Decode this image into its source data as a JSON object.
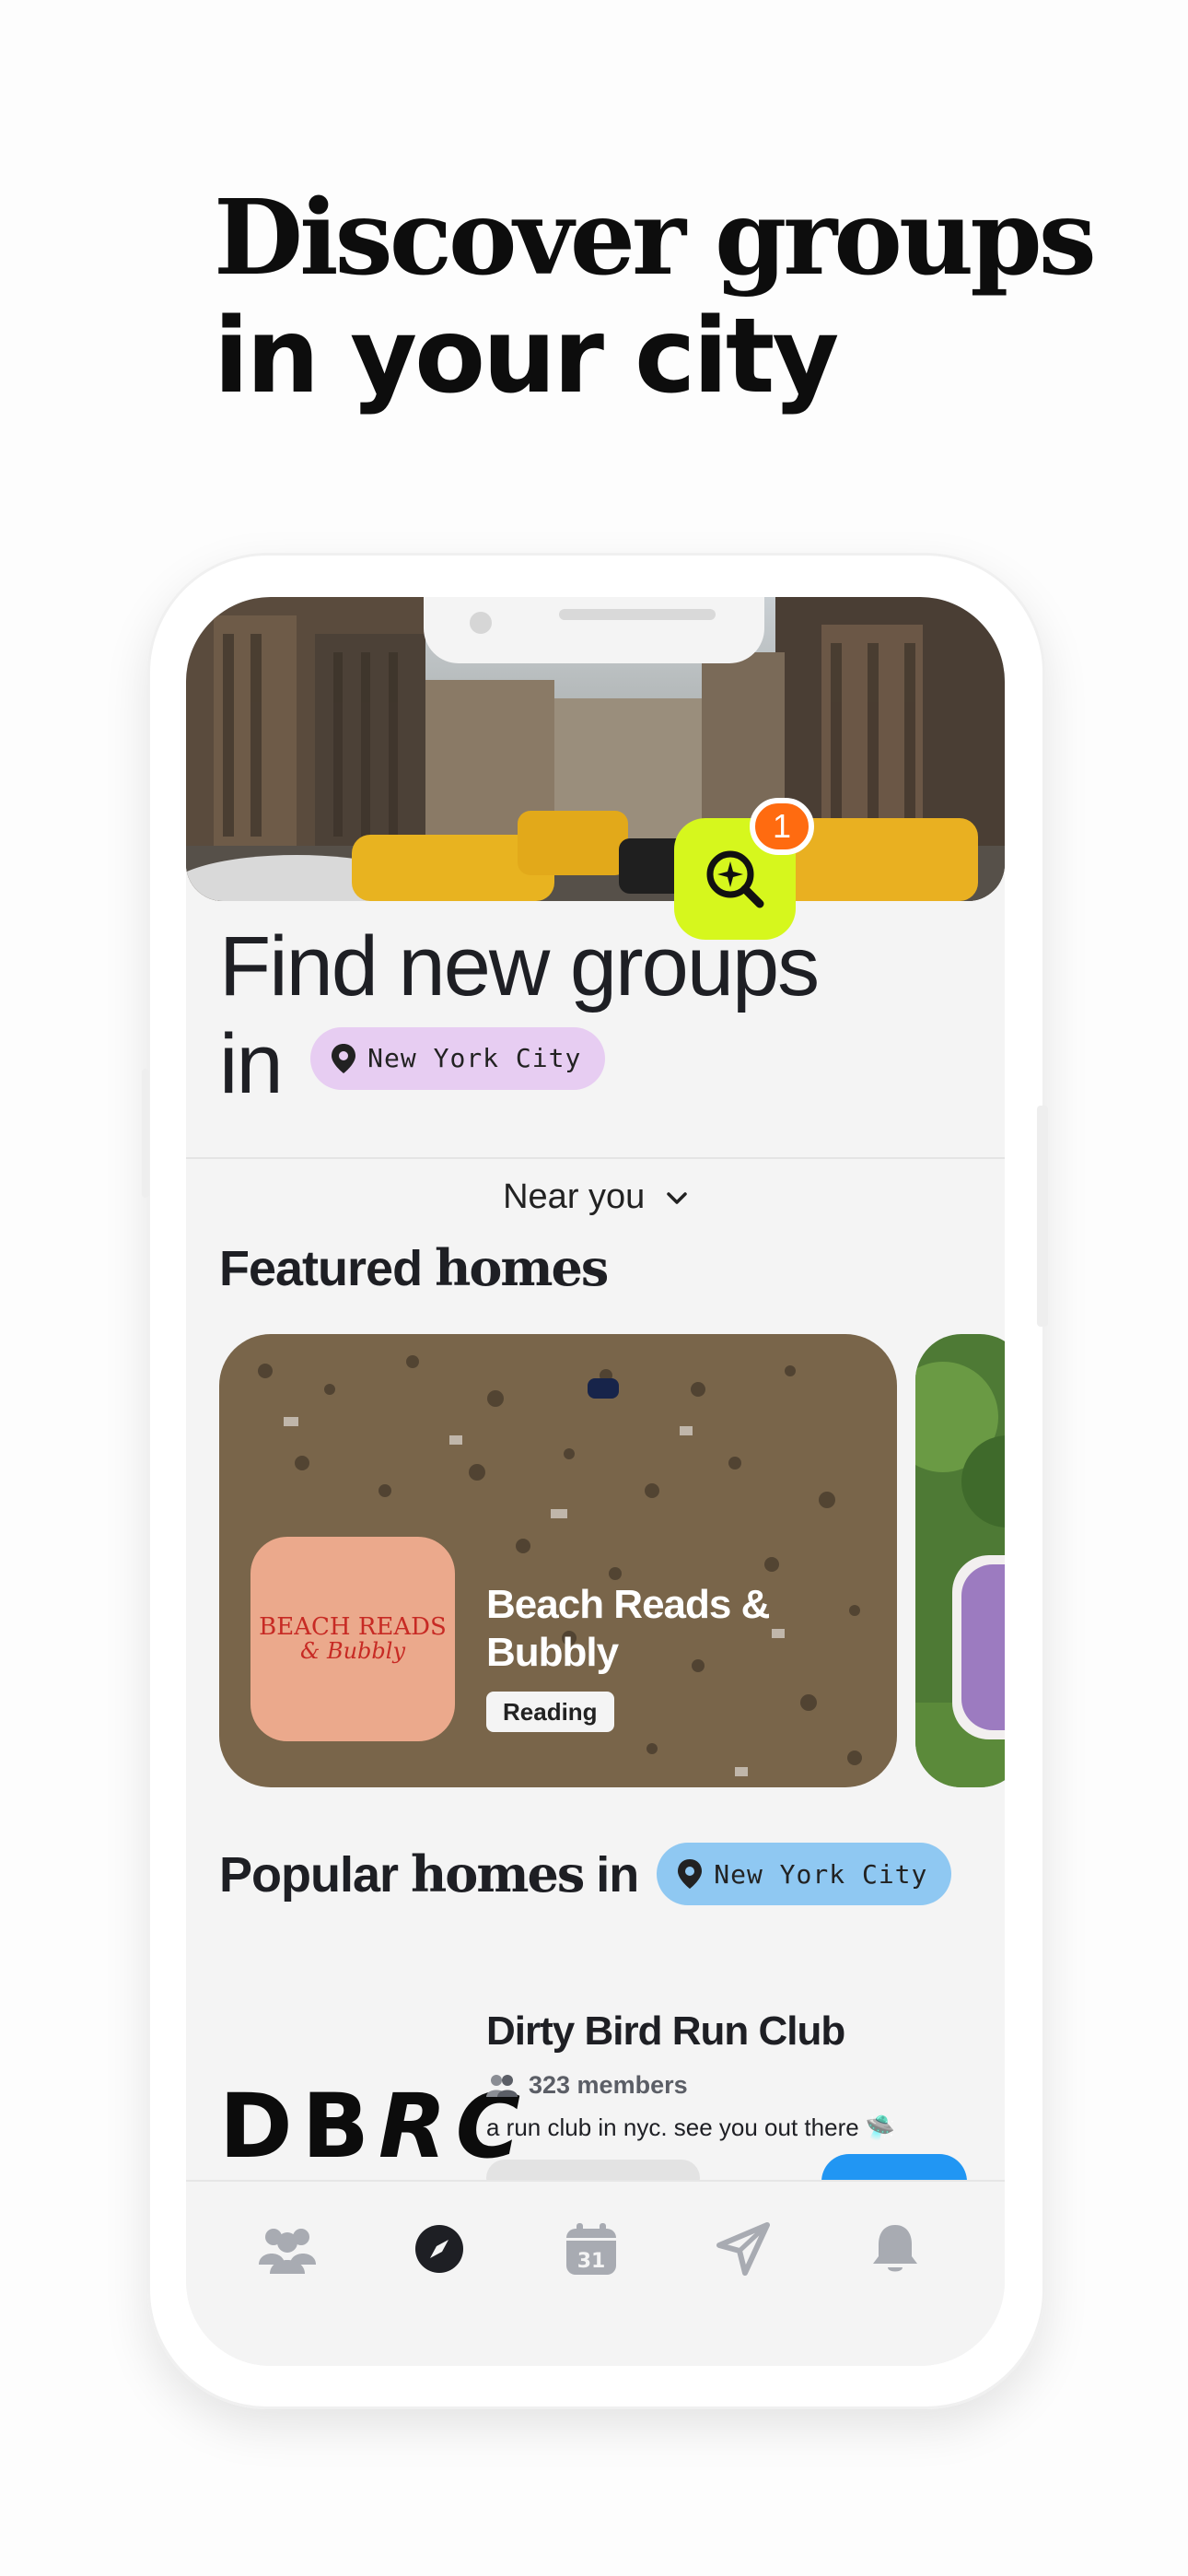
{
  "headline": {
    "line1": "Discover groups",
    "line2": "in your city"
  },
  "hero": {
    "notification_count": "1"
  },
  "find": {
    "title_line1": "Find new groups",
    "title_in": "in",
    "city": "New York City"
  },
  "near_you": {
    "label": "Near you"
  },
  "featured": {
    "title_plain": "Featured",
    "title_bold": "homes",
    "cards": [
      {
        "name": "Beach Reads & Bubbly",
        "tag": "Reading",
        "cover_line1": "BEACH READS",
        "cover_line2": "& Bubbly"
      }
    ]
  },
  "popular": {
    "title_plain": "Popular",
    "title_bold": "homes",
    "title_in": "in",
    "city": "New York City",
    "items": [
      {
        "logo_a": "DB",
        "logo_b": "RC",
        "name": "Dirty Bird Run Club",
        "members": "323 members",
        "description": "a run club in nyc. see you out there 🛸"
      }
    ]
  },
  "tabbar": {
    "items": [
      "groups-icon",
      "compass-icon",
      "calendar-icon",
      "send-icon",
      "bell-icon"
    ],
    "calendar_day": "31",
    "active": 1
  },
  "colors": {
    "accent_lime": "#d6f71d",
    "badge_orange": "#ff6b10",
    "pill_purple": "#e7cdf2",
    "pill_blue": "#8fc8f2",
    "join_blue": "#2196f3"
  }
}
